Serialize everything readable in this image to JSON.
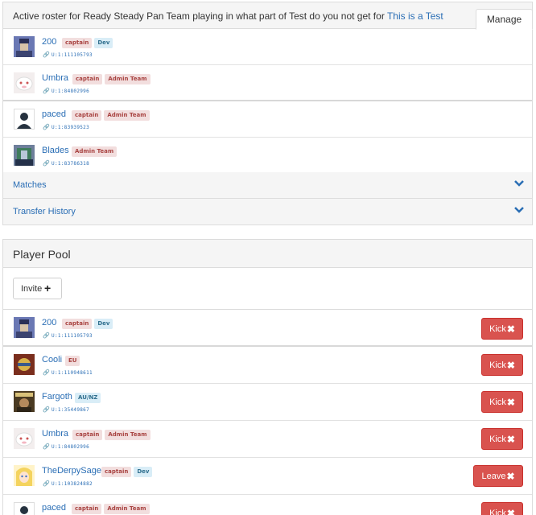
{
  "roster": {
    "title_prefix": "Active roster for Ready Steady Pan Team playing in what part of Test do you not get for",
    "title_link": "This is a Test",
    "manage_tab": "Manage",
    "players": [
      {
        "name": "200",
        "badges": [
          "captain",
          "Dev"
        ],
        "steam_id": "U:1:111105793"
      },
      {
        "name": "Umbra",
        "badges": [
          "captain",
          "Admin Team"
        ],
        "steam_id": "U:1:84802996"
      },
      {
        "name": "paced",
        "badges": [
          "captain",
          "Admin Team"
        ],
        "steam_id": "U:1:83939523"
      },
      {
        "name": "Blades",
        "badges": [
          "Admin Team"
        ],
        "steam_id": "U:1:83786318"
      }
    ],
    "sections": [
      "Matches",
      "Transfer History"
    ]
  },
  "pool": {
    "title": "Player Pool",
    "invite_label": "Invite",
    "players": [
      {
        "name": "200",
        "badges": [
          "captain",
          "Dev"
        ],
        "steam_id": "U:1:111105793",
        "action": "Kick"
      },
      {
        "name": "Cooli",
        "badges": [
          "EU"
        ],
        "steam_id": "U:1:110948611",
        "action": "Kick"
      },
      {
        "name": "Fargoth",
        "badges": [
          "AU/NZ"
        ],
        "steam_id": "U:1:35449867",
        "action": "Kick"
      },
      {
        "name": "Umbra",
        "badges": [
          "captain",
          "Admin Team"
        ],
        "steam_id": "U:1:84802996",
        "action": "Kick"
      },
      {
        "name": "TheDerpySage",
        "badges": [
          "captain",
          "Dev"
        ],
        "steam_id": "U:1:103824882",
        "action": "Leave"
      },
      {
        "name": "paced",
        "badges": [
          "captain",
          "Admin Team"
        ],
        "steam_id": "",
        "action": "Kick"
      }
    ]
  },
  "colors": {
    "link": "#2a6eb5",
    "danger": "#d9534f",
    "badge_red_bg": "#f2dede",
    "badge_blue_bg": "#d9edf7",
    "panel_header_bg": "#f5f5f5"
  }
}
